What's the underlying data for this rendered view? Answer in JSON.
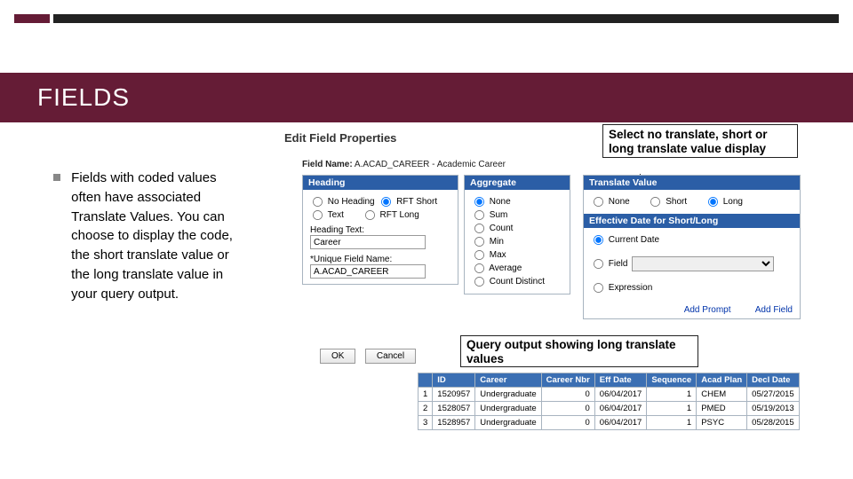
{
  "title": "FIELDS",
  "bullet_text": "Fields with coded values often have associated Translate Values. You can choose to display the code, the short translate value or the long translate value in your query output.",
  "callout1": "Select no translate, short or long translate value display",
  "callout2": "Query output showing long translate values",
  "panel_title": "Edit Field Properties",
  "field_name_label": "Field Name:",
  "field_name_value": "A.ACAD_CAREER - Academic Career",
  "heading": {
    "hdr": "Heading",
    "no_heading": "No Heading",
    "rft_short": "RFT Short",
    "text": "Text",
    "rft_long": "RFT Long",
    "heading_text_label": "Heading Text:",
    "heading_text_value": "Career",
    "unique_label": "*Unique Field Name:",
    "unique_value": "A.ACAD_CAREER"
  },
  "aggregate": {
    "hdr": "Aggregate",
    "items": [
      "None",
      "Sum",
      "Count",
      "Min",
      "Max",
      "Average",
      "Count Distinct"
    ]
  },
  "translate": {
    "hdr": "Translate Value",
    "none": "None",
    "short": "Short",
    "long": "Long",
    "effdt_hdr": "Effective Date for Short/Long",
    "current": "Current Date",
    "field": "Field",
    "expression": "Expression",
    "add_prompt": "Add Prompt",
    "add_field": "Add Field"
  },
  "buttons": {
    "ok": "OK",
    "cancel": "Cancel"
  },
  "table": {
    "headers": [
      "",
      "ID",
      "Career",
      "Career Nbr",
      "Eff Date",
      "Sequence",
      "Acad Plan",
      "Decl Date"
    ],
    "rows": [
      [
        "1",
        "1520957",
        "Undergraduate",
        "0",
        "06/04/2017",
        "1",
        "CHEM",
        "05/27/2015"
      ],
      [
        "2",
        "1528057",
        "Undergraduate",
        "0",
        "06/04/2017",
        "1",
        "PMED",
        "05/19/2013"
      ],
      [
        "3",
        "1528957",
        "Undergraduate",
        "0",
        "06/04/2017",
        "1",
        "PSYC",
        "05/28/2015"
      ]
    ]
  }
}
